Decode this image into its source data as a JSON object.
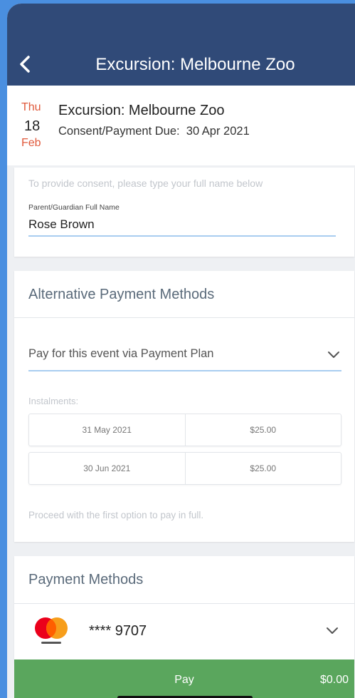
{
  "header": {
    "title": "Excursion: Melbourne Zoo",
    "bg_color": "#304a78"
  },
  "event": {
    "day_of_week": "Thu",
    "day": "18",
    "month": "Feb",
    "title": "Excursion: Melbourne Zoo",
    "due_label": "Consent/Payment Due:",
    "due_date": "30 Apr 2021"
  },
  "consent": {
    "hint": "To provide consent, please type your full name below",
    "field_label": "Parent/Guardian Full Name",
    "field_value": "Rose Brown"
  },
  "alt_payment": {
    "heading": "Alternative Payment Methods",
    "selected_option": "Pay for this event via Payment Plan",
    "instalments_label": "Instalments:",
    "instalments": [
      {
        "date": "31 May 2021",
        "amount": "$25.00"
      },
      {
        "date": "30 Jun 2021",
        "amount": "$25.00"
      }
    ],
    "note": "Proceed with the first option to pay in full."
  },
  "payment_methods": {
    "heading": "Payment Methods",
    "card_brand": "mastercard",
    "card_number": "**** 9707"
  },
  "pay": {
    "label": "Pay",
    "amount": "$0.00",
    "color": "#5aa65d"
  }
}
